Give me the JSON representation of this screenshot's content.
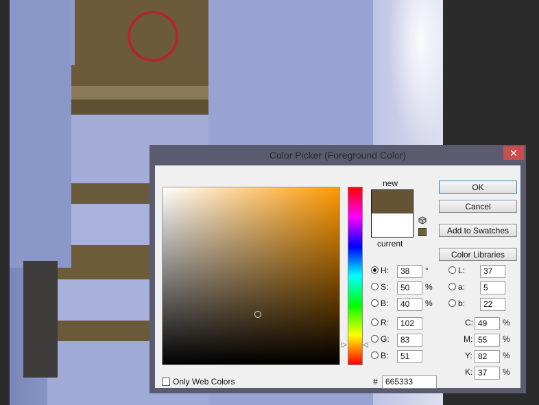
{
  "dialog": {
    "title": "Color Picker (Foreground Color)",
    "close_glyph": "✕"
  },
  "swatch": {
    "new_label": "new",
    "current_label": "current",
    "new_color": "#665333",
    "current_color": "#ffffff"
  },
  "buttons": {
    "ok": "OK",
    "cancel": "Cancel",
    "add_swatches": "Add to Swatches",
    "color_libraries": "Color Libraries"
  },
  "hsb": {
    "h": {
      "label": "H:",
      "value": "38",
      "unit": "°"
    },
    "s": {
      "label": "S:",
      "value": "50",
      "unit": "%"
    },
    "b": {
      "label": "B:",
      "value": "40",
      "unit": "%"
    }
  },
  "rgb": {
    "r": {
      "label": "R:",
      "value": "102"
    },
    "g": {
      "label": "G:",
      "value": "83"
    },
    "b": {
      "label": "B:",
      "value": "51"
    }
  },
  "lab": {
    "l": {
      "label": "L:",
      "value": "37"
    },
    "a": {
      "label": "a:",
      "value": "5"
    },
    "b": {
      "label": "b:",
      "value": "22"
    }
  },
  "cmyk": {
    "c": {
      "label": "C:",
      "value": "49",
      "unit": "%"
    },
    "m": {
      "label": "M:",
      "value": "55",
      "unit": "%"
    },
    "y": {
      "label": "Y:",
      "value": "82",
      "unit": "%"
    },
    "k": {
      "label": "K:",
      "value": "37",
      "unit": "%"
    }
  },
  "hex": {
    "label": "#",
    "value": "665333"
  },
  "only_web_colors": "Only Web Colors",
  "icons": {
    "gamut": "cube-icon",
    "web_safe": "web-safe-swatch-icon"
  },
  "colors": {
    "dress_blue": "#9aa6d6",
    "dress_gold": "#6e5a35",
    "highlight_circle": "#b3262e"
  }
}
